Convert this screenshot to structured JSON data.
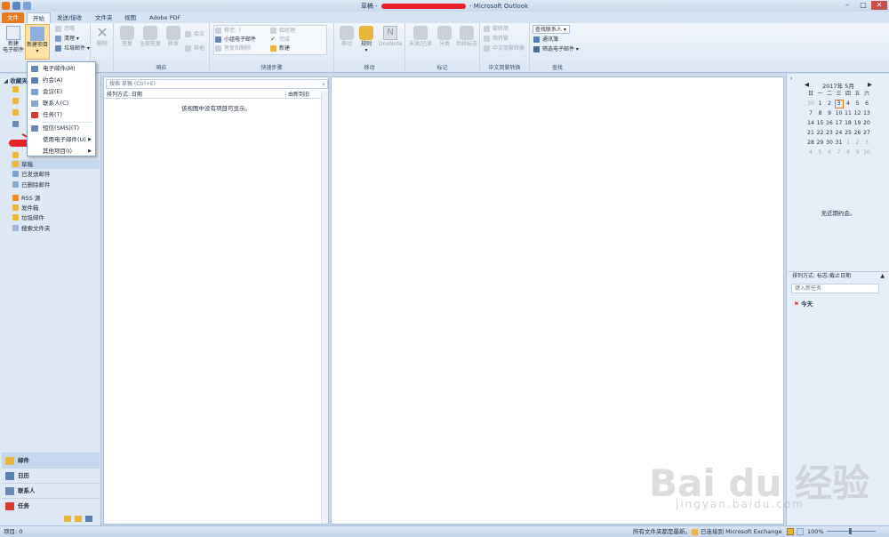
{
  "window": {
    "title_prefix": "草稿 - ",
    "title_suffix": " - Microsoft Outlook"
  },
  "tabs": [
    "文件",
    "开始",
    "发送/接收",
    "文件夹",
    "视图",
    "Adobe PDF"
  ],
  "ribbon": {
    "new_email": "新建\n电子邮件",
    "new_items": "新建项目",
    "ignore": "忽略",
    "cleanup": "清理",
    "junk": "垃圾邮件",
    "delete": "删除",
    "reply": "答复",
    "reply_all": "全部答复",
    "forward": "转发",
    "meeting": "会议",
    "more": "其他",
    "group_respond": "响应",
    "qs_move": "移至: ?",
    "qs_team": "小组电子邮件",
    "qs_reply_delete": "答复和删除",
    "qs_manager": "给经理",
    "qs_done": "完成",
    "qs_new": "新建",
    "group_quick": "快速步骤",
    "move": "移动",
    "rules": "规则",
    "onenote": "OneNote",
    "group_move": "移动",
    "unread": "未读/已读",
    "categorize": "分类",
    "followup": "后续标志",
    "group_tags": "标记",
    "to_trad": "繁转简",
    "to_simp": "简转繁",
    "conv": "中文简繁转换",
    "group_chinese": "中文简繁转换",
    "find_contact": "查找联系人",
    "address_book": "通讯簿",
    "filter_email": "筛选电子邮件",
    "group_find": "查找"
  },
  "menu": {
    "items": [
      "电子邮件(M)",
      "约会(A)",
      "会议(E)",
      "联系人(C)",
      "任务(T)",
      "短信(SMS)(T)",
      "使用电子邮件(U)",
      "其他项目(I)"
    ]
  },
  "nav": {
    "favorites": "收藏夹",
    "folders": [
      "草稿",
      "已发送邮件",
      "已删除邮件",
      "RSS 源",
      "发件箱",
      "垃圾邮件",
      "搜索文件夹"
    ],
    "bottom": [
      "邮件",
      "日历",
      "联系人",
      "任务"
    ]
  },
  "list": {
    "search_placeholder": "搜索 草稿 (Ctrl+E)",
    "arrange": "排列方式: 日期",
    "order": "由新到旧",
    "empty": "该视图中没有项目可显示。"
  },
  "calendar": {
    "title": "2017年 5月",
    "weekdays": [
      "日",
      "一",
      "二",
      "三",
      "四",
      "五",
      "六"
    ],
    "rows": [
      [
        "30",
        "1",
        "2",
        "3",
        "4",
        "5",
        "6"
      ],
      [
        "7",
        "8",
        "9",
        "10",
        "11",
        "12",
        "13"
      ],
      [
        "14",
        "15",
        "16",
        "17",
        "18",
        "19",
        "20"
      ],
      [
        "21",
        "22",
        "23",
        "24",
        "25",
        "26",
        "27"
      ],
      [
        "28",
        "29",
        "30",
        "31",
        "1",
        "2",
        "3"
      ],
      [
        "4",
        "5",
        "6",
        "7",
        "8",
        "9",
        "10"
      ]
    ],
    "no_appointments": "无近期约会。"
  },
  "tasks": {
    "arrange": "排列方式: 标志:截止日期",
    "new_placeholder": "键入新任务",
    "today": "今天"
  },
  "status": {
    "items": "项目: 0",
    "updated": "所有文件夹都是最新。",
    "connected": "已连接到 Microsoft Exchange",
    "zoom": "100%"
  },
  "watermark": {
    "main": "Bai du 经验",
    "sub": "jingyan.baidu.com"
  },
  "colors": {
    "file_tab": "#e77a1e",
    "accent_blue": "#1e395b",
    "redaction": "#e8202a"
  }
}
